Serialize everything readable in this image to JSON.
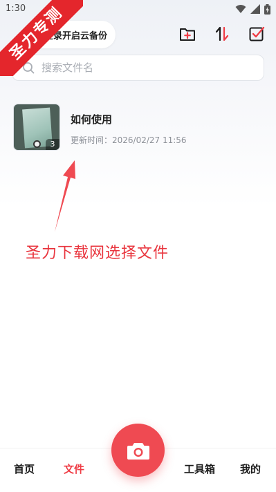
{
  "status_bar": {
    "time": "1:30"
  },
  "ribbon": {
    "text": "圣力专测"
  },
  "header": {
    "login_label": "登录开启云备份",
    "icons": [
      "new-folder-icon",
      "sort-icon",
      "select-icon"
    ]
  },
  "search": {
    "placeholder": "搜索文件名",
    "value": ""
  },
  "files": [
    {
      "name": "如何使用",
      "meta": "更新时间：2026/02/27 11:56",
      "count": "3"
    }
  ],
  "annotation": {
    "text": "圣力下载网选择文件"
  },
  "bottom_nav": {
    "items": [
      {
        "label": "首页"
      },
      {
        "label": "文件"
      },
      {
        "label": "工具箱"
      },
      {
        "label": "我的"
      }
    ],
    "active": "文件"
  },
  "colors": {
    "accent": "#ef4a52",
    "ribbon": "#e4262c",
    "annotation": "#e9343d"
  }
}
